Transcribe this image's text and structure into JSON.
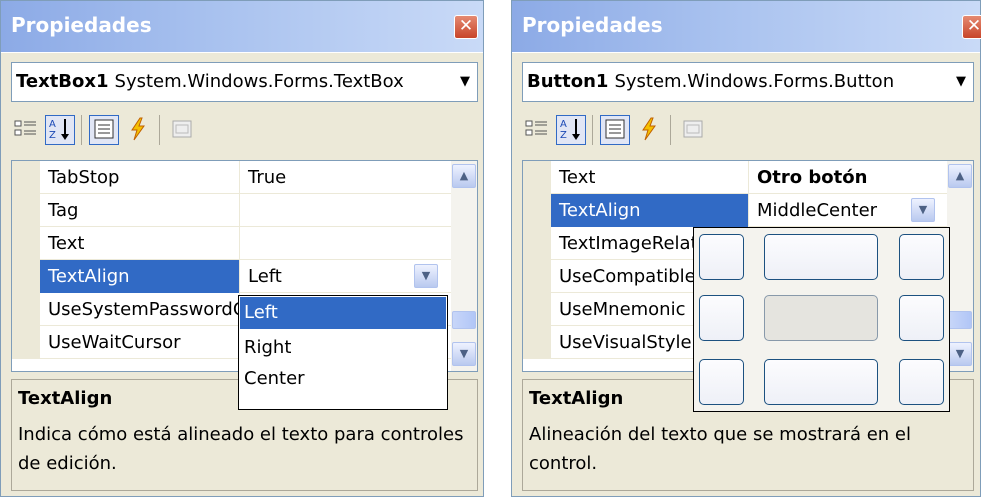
{
  "left_panel": {
    "title": "Propiedades",
    "close_glyph": "✕",
    "object_name": "TextBox1",
    "object_type": "System.Windows.Forms.TextBox",
    "rows": [
      {
        "name": "TabStop",
        "value": "True"
      },
      {
        "name": "Tag",
        "value": ""
      },
      {
        "name": "Text",
        "value": ""
      },
      {
        "name": "TextAlign",
        "value": "Left"
      },
      {
        "name": "UseSystemPasswordChar",
        "value": ""
      },
      {
        "name": "UseWaitCursor",
        "value": ""
      }
    ],
    "dropdown_options": [
      "Left",
      "Right",
      "Center"
    ],
    "dropdown_selected": "Left",
    "description_title": "TextAlign",
    "description_text": "Indica cómo está alineado el texto para controles de edición."
  },
  "right_panel": {
    "title": "Propiedades",
    "close_glyph": "✕",
    "object_name": "Button1",
    "object_type": "System.Windows.Forms.Button",
    "rows": [
      {
        "name": "Text",
        "value": "Otro botón"
      },
      {
        "name": "TextAlign",
        "value": "MiddleCenter"
      },
      {
        "name": "TextImageRelation",
        "value": ""
      },
      {
        "name": "UseCompatibleTextRendering",
        "value": ""
      },
      {
        "name": "UseMnemonic",
        "value": ""
      },
      {
        "name": "UseVisualStyleBackColor",
        "value": ""
      }
    ],
    "align_picker_selected": "MiddleCenter",
    "description_title": "TextAlign",
    "description_text": "Alineación del texto que se mostrará en el control."
  },
  "toolbar_icons": [
    "categorized-icon",
    "alphabetical-icon",
    "properties-icon",
    "events-icon",
    "property-pages-icon"
  ],
  "colors": {
    "selection": "#316ac5",
    "title_gradient_start": "#8caae6",
    "panel_bg": "#ece9d8"
  }
}
